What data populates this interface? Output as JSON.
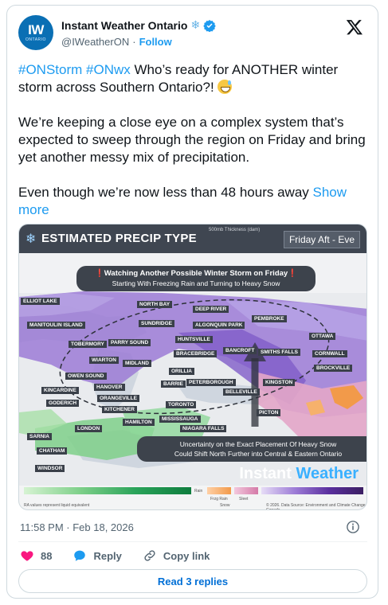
{
  "account": {
    "display_name": "Instant Weather Ontario",
    "handle": "@IWeatherON",
    "separator": "·",
    "follow_label": "Follow",
    "avatar_text": "IW",
    "avatar_subtext": "ONTARIO"
  },
  "tweet": {
    "hashtag1": "#ONStorm",
    "hashtag2": "#ONwx",
    "line1_rest": " Who’s ready for ANOTHER winter storm across Southern Ontario?! ",
    "para2": "We’re keeping a close eye on a complex system that’s expected to sweep through the region on Friday and bring yet another messy mix of precipitation.",
    "para3": "Even though we’re now less than 48 hours away ",
    "show_more": "Show more"
  },
  "map": {
    "title": "ESTIMATED PRECIP TYPE",
    "time_label": "Friday Aft - Eve",
    "thickness_label": "500mb Thickness (dam)",
    "callout_top_title": "Watching Another Possible Winter Storm on Friday",
    "callout_top_sub": "Starting With Freezing Rain and Turning to Heavy Snow",
    "callout_bottom_1": "Uncertainty on the Exact Placement Of Heavy Snow",
    "callout_bottom_2": "Could Shift North Further into Central & Eastern Ontario",
    "brand_a": "Instant ",
    "brand_b": "Weather",
    "cities": [
      "ELLIOT LAKE",
      "NORTH BAY",
      "DEEP RIVER",
      "MANITOULIN ISLAND",
      "SUNDRIDGE",
      "ALGONQUIN PARK",
      "PEMBROKE",
      "TOBERMORY",
      "PARRY SOUND",
      "OTTAWA",
      "HUNTSVILLE",
      "WIARTON",
      "MIDLAND",
      "BRACEBRIDGE",
      "BANCROFT",
      "SMITHS FALLS",
      "CORNWALL",
      "OWEN SOUND",
      "ORILLIA",
      "BARRIE",
      "PETERBOROUGH",
      "BROCKVILLE",
      "KINCARDINE",
      "HANOVER",
      "KINGSTON",
      "BELLEVILLE",
      "GODERICH",
      "ORANGEVILLE",
      "TORONTO",
      "KITCHENER",
      "PICTON",
      "HAMILTON",
      "MISSISSAUGA",
      "LONDON",
      "NIAGARA FALLS",
      "SARNIA",
      "CHATHAM",
      "WINDSOR"
    ],
    "legend_rain": "Rain",
    "legend_freezing": "Frzg Rain",
    "legend_sleet": "Sleet",
    "legend_snow": "Snow",
    "legend_note": "RA values represent liquid equivalent",
    "legend_credit": "© 2026. Data Source: Environment and Climate Change Canada"
  },
  "meta": {
    "timestamp": "11:58 PM · Feb 18, 2026"
  },
  "actions": {
    "like_count": "88",
    "reply_label": "Reply",
    "copy_link_label": "Copy link",
    "read_replies_label": "Read 3 replies"
  },
  "colors": {
    "link": "#1d9bf0",
    "text": "#0f1419",
    "muted": "#536471",
    "like": "#f91880",
    "reply": "#1d9bf0"
  }
}
